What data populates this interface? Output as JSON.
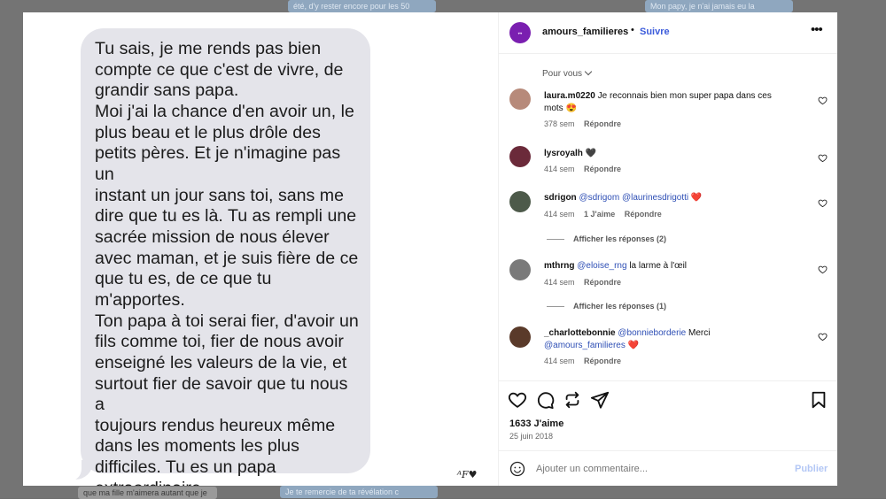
{
  "background": {
    "top_center": "été, d'y rester encore pour les 50",
    "top_right": "Mon papy, je n'ai jamais eu la",
    "bottom_left": "que ma fille m'aimera autant que je",
    "bottom_center": "Je te remercie de ta révélation c"
  },
  "message": {
    "text": "Tu sais, je me rends pas bien\ncompte ce que c'est de vivre, de\ngrandir sans papa.\nMoi j'ai la chance d'en avoir un, le\nplus beau et le plus drôle des\npetits pères. Et je n'imagine pas un\ninstant un jour sans toi, sans me\ndire que tu es là. Tu as rempli une\nsacrée mission de nous élever\navec maman, et je suis fière de ce\nque tu es, de ce que tu\nm'apportes.\nTon papa à toi serai fier, d'avoir un\nfils comme toi, fier de nous avoir\nenseigné les valeurs de la vie, et\nsurtout fier de savoir que tu nous a\ntoujours rendus heureux même\ndans les moments les plus\ndifficiles. Tu es un papa\nextraordinaire.\nJe t'aime.",
    "signature": "ᴬF♥"
  },
  "post": {
    "username": "amours_familieres",
    "separator": "•",
    "follow_label": "Suivre",
    "more_icon": "•••",
    "sort_label": "Pour vous",
    "likes": "1633 J'aime",
    "date": "25 juin 2018",
    "add_comment_placeholder": "Ajouter un commentaire...",
    "publish_label": "Publier"
  },
  "comments": [
    {
      "user": "laura.m0220",
      "mention": "",
      "text": "Je reconnais bien mon super papa dans ces mots 😍",
      "time": "378 sem",
      "likes": "",
      "reply": "Répondre",
      "avatar_color": "#b78a7a"
    },
    {
      "user": "lysroyalh",
      "mention": "",
      "text": "🖤",
      "time": "414 sem",
      "likes": "",
      "reply": "Répondre",
      "avatar_color": "#6b2a3a"
    },
    {
      "user": "sdrigon",
      "mention": "@sdrigom @laurinesdrigotti",
      "text": "❤️",
      "time": "414 sem",
      "likes": "1 J'aime",
      "reply": "Répondre",
      "avatar_color": "#4d5a4a",
      "view_replies": "Afficher les réponses (2)"
    },
    {
      "user": "mthrng",
      "mention": "@eloise_rng",
      "text": "la larme à l'œil",
      "time": "414 sem",
      "likes": "",
      "reply": "Répondre",
      "avatar_color": "#7a7a7a",
      "view_replies": "Afficher les réponses (1)"
    },
    {
      "user": "_charlottebonnie",
      "mention": "@bonnieborderie",
      "text": "Merci",
      "mention2": "@amours_familieres",
      "text2": "❤️",
      "time": "414 sem",
      "likes": "",
      "reply": "Répondre",
      "avatar_color": "#5a3a2a"
    }
  ],
  "icons": {
    "like": "heart-icon",
    "comment": "comment-icon",
    "share": "share-icon",
    "send": "send-icon",
    "save": "bookmark-icon",
    "emoji": "emoji-icon"
  }
}
